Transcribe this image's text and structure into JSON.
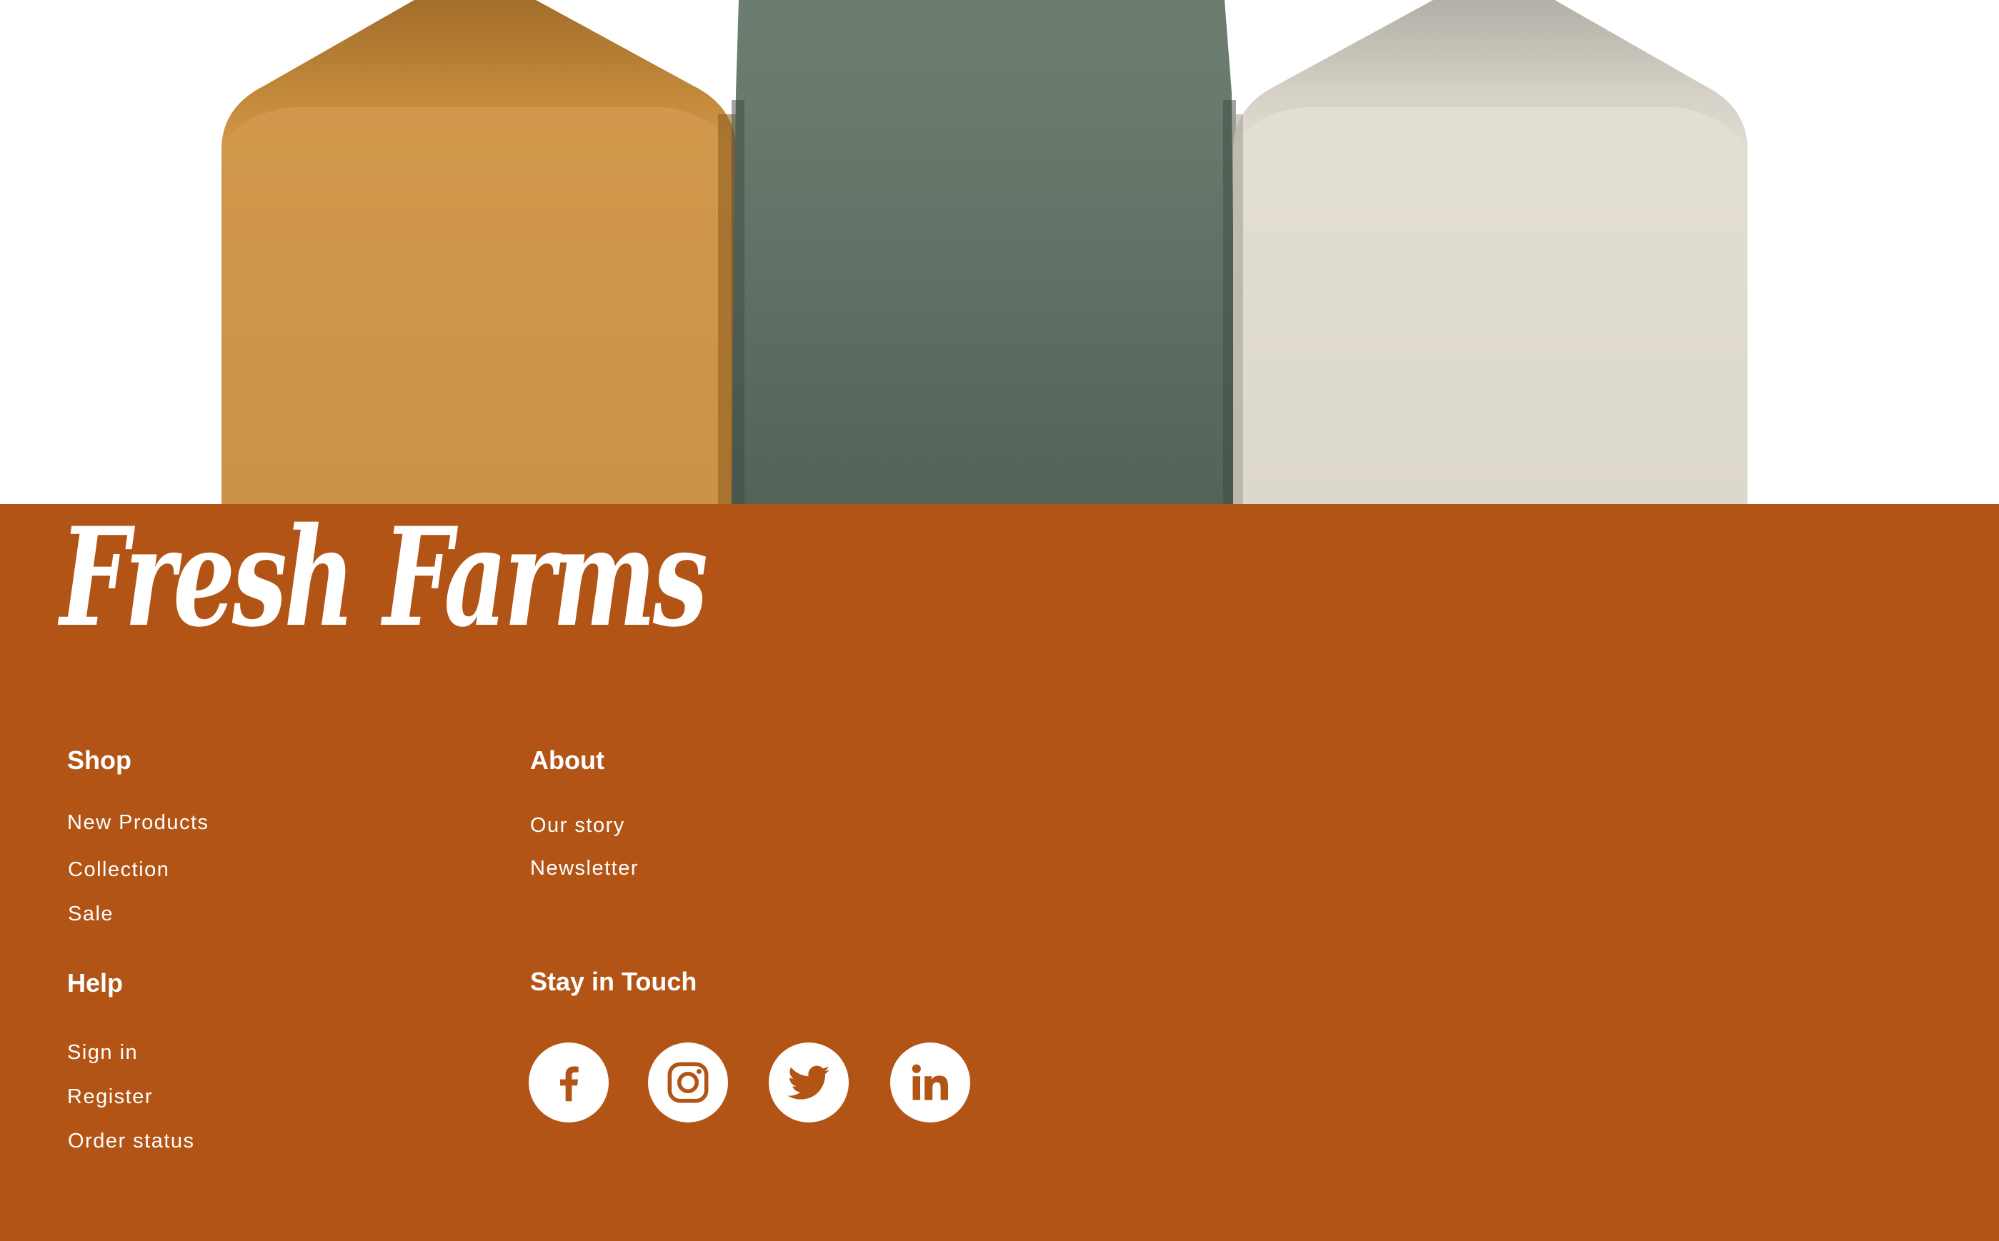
{
  "brand": {
    "name": "Fresh Farms"
  },
  "colors": {
    "footer_bg": "#b25416",
    "carton_orange": "#cf9446",
    "carton_green": "#5d7062",
    "carton_cream": "#e1dcd1",
    "text": "#ffffff"
  },
  "hero": {
    "cartons": [
      "orange-carton",
      "green-carton",
      "cream-carton"
    ]
  },
  "footer": {
    "shop": {
      "heading": "Shop",
      "links": [
        "New Products",
        "Collection",
        "Sale"
      ]
    },
    "about": {
      "heading": "About",
      "links": [
        "Our story",
        "Newsletter"
      ]
    },
    "help": {
      "heading": "Help",
      "links": [
        "Sign in",
        "Register",
        "Order status"
      ]
    },
    "social": {
      "heading": "Stay in Touch",
      "icons": [
        "facebook-icon",
        "instagram-icon",
        "twitter-icon",
        "linkedin-icon"
      ]
    }
  }
}
